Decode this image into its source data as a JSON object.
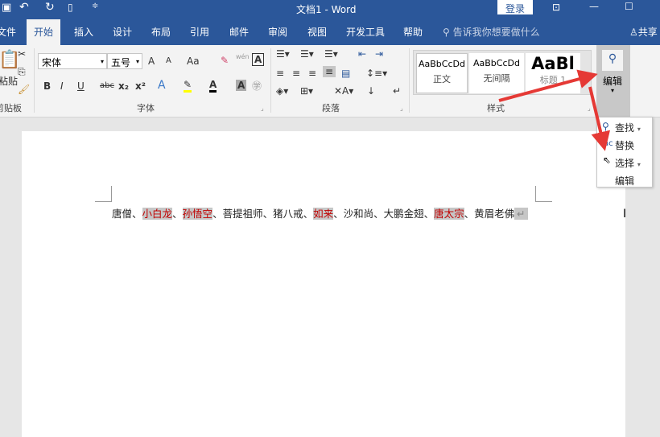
{
  "title": {
    "doc": "文档1",
    "sep": " - ",
    "app": "Word",
    "login": "登录",
    "qat_undo": "↶",
    "qat_redo": "↻"
  },
  "tabs": [
    "文件",
    "开始",
    "插入",
    "设计",
    "布局",
    "引用",
    "邮件",
    "审阅",
    "视图",
    "开发工具",
    "帮助"
  ],
  "tell_me": "告诉我你想要做什么",
  "share": "共享",
  "ribbon": {
    "clipboard": {
      "paste": "粘贴",
      "label": "剪贴板"
    },
    "font": {
      "name": "宋体",
      "size": "五号",
      "label": "字体",
      "bold": "B",
      "italic": "I",
      "underline": "U",
      "strike": "abc",
      "sub": "x₂",
      "sup": "x²",
      "grow": "A",
      "shrink": "A",
      "case": "Aa",
      "wen": "wén"
    },
    "paragraph": {
      "label": "段落"
    },
    "styles": {
      "items": [
        {
          "preview": "AaBbCcDd",
          "name": "正文"
        },
        {
          "preview": "AaBbCcDd",
          "name": "无间隔"
        },
        {
          "preview": "AaBl",
          "name": "标题 1"
        }
      ],
      "label": "样式"
    },
    "editing": {
      "label": "编辑"
    }
  },
  "menu": {
    "items": [
      "查找",
      "替换",
      "选择",
      "编辑"
    ]
  },
  "document": {
    "segments": [
      {
        "text": "唐僧、",
        "hl": false
      },
      {
        "text": "小白龙",
        "hl": true
      },
      {
        "text": "、",
        "hl": false
      },
      {
        "text": "孙悟空",
        "hl": true
      },
      {
        "text": "、菩提祖师、猪八戒、",
        "hl": false
      },
      {
        "text": "如来",
        "hl": true
      },
      {
        "text": "、沙和尚、大鹏金翅、",
        "hl": false
      },
      {
        "text": "唐太宗",
        "hl": true
      },
      {
        "text": "、黄眉老佛",
        "hl": false
      }
    ],
    "para_mark": "↵"
  },
  "colors": {
    "brand": "#2b579a",
    "highlight_text": "#c00000",
    "highlight_bg": "#c6c6c6",
    "arrow": "#e53935"
  }
}
